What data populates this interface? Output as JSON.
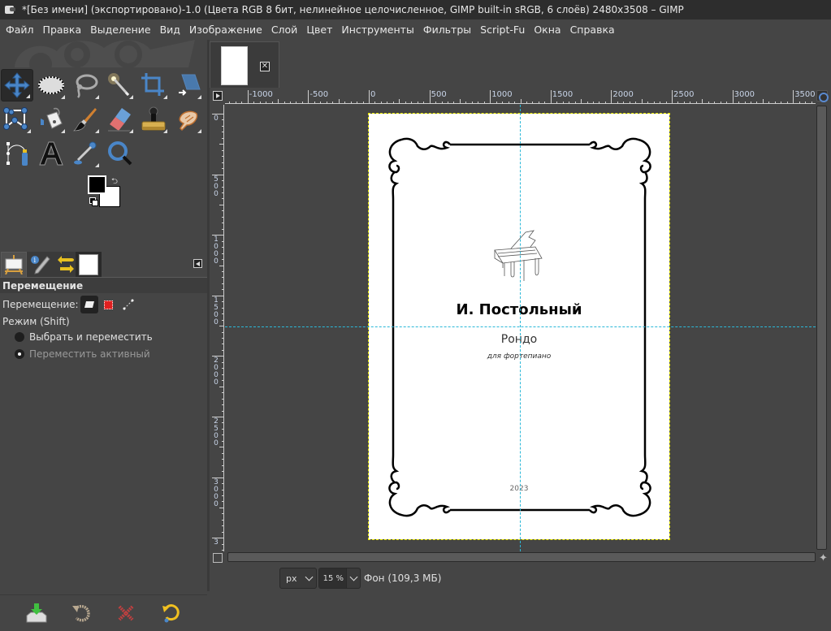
{
  "window": {
    "title": "*[Без имени] (экспортировано)-1.0 (Цвета RGB 8 бит, нелинейное целочисленное, GIMP built-in sRGB, 6 слоёв) 2480x3508 – GIMP"
  },
  "menubar": {
    "items": [
      "Файл",
      "Правка",
      "Выделение",
      "Вид",
      "Изображение",
      "Слой",
      "Цвет",
      "Инструменты",
      "Фильтры",
      "Script-Fu",
      "Окна",
      "Справка"
    ]
  },
  "toolbox": {
    "tools": [
      {
        "name": "move-tool",
        "active": true
      },
      {
        "name": "ellipse-select-tool"
      },
      {
        "name": "free-select-tool"
      },
      {
        "name": "fuzzy-select-tool"
      },
      {
        "name": "crop-tool"
      },
      {
        "name": "unified-transform-tool"
      },
      {
        "name": "cage-transform-tool"
      },
      {
        "name": "bucket-fill-tool"
      },
      {
        "name": "paintbrush-tool"
      },
      {
        "name": "eraser-tool"
      },
      {
        "name": "clone-tool"
      },
      {
        "name": "smudge-tool"
      },
      {
        "name": "paths-tool"
      },
      {
        "name": "text-tool"
      },
      {
        "name": "color-picker-tool"
      },
      {
        "name": "zoom-tool"
      }
    ],
    "foreground_color": "#000000",
    "background_color": "#ffffff"
  },
  "dock": {
    "tabs": [
      "tool-options",
      "device-status",
      "undo-history",
      "images"
    ],
    "tool_options": {
      "title": "Перемещение",
      "move_label": "Перемещение:",
      "move_modes": [
        "layer",
        "selection",
        "path"
      ],
      "move_mode_selected": "layer",
      "mode_label": "Режим  (Shift)",
      "radio_options": [
        {
          "label": "Выбрать и переместить",
          "selected": false
        },
        {
          "label": "Переместить активный",
          "selected": true
        }
      ]
    },
    "bottom_buttons": [
      "save-tool-preset",
      "restore-tool-preset",
      "delete-tool-preset",
      "reset-tool-options"
    ]
  },
  "image_tab": {
    "close_label": "✕"
  },
  "rulers": {
    "horizontal_labels": [
      "-1000",
      "-500",
      "0",
      "500",
      "1000",
      "1500",
      "2000",
      "2500",
      "3000",
      "3500"
    ],
    "vertical_labels": [
      "0",
      "500",
      "1000",
      "1500",
      "2000",
      "2500",
      "3000",
      "3"
    ]
  },
  "canvas": {
    "document": {
      "author": "И. Постольный",
      "title": "Рондо",
      "subtitle": "для фортепиано",
      "year": "2023"
    },
    "image_size": "2480x3508"
  },
  "statusbar": {
    "unit": "px",
    "zoom": "15 %",
    "layer_info": "Фон (109,3 МБ)"
  },
  "colors": {
    "accent_blue": "#4a86c8",
    "guide_color": "#2bb8d8",
    "selection_border": "#e8e800",
    "panel_bg": "#454545",
    "titlebar_bg": "#2d2d2d"
  }
}
